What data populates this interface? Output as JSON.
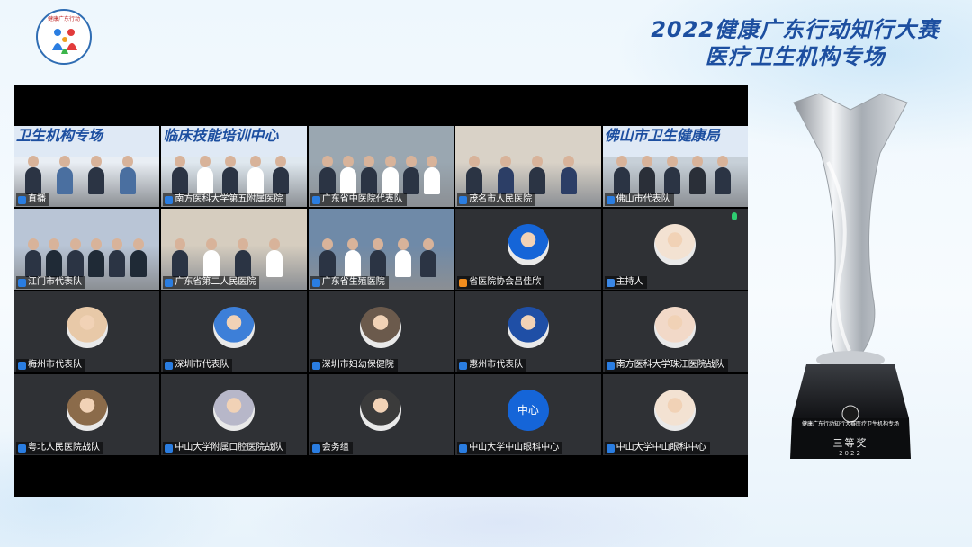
{
  "event": {
    "title_line1": "2022健康广东行动知行大赛",
    "title_line2": "医疗卫生机构专场",
    "logo_text": "健康广东行动"
  },
  "tiles": [
    {
      "name": "直播",
      "kind": "video",
      "icon": "screen-share-icon",
      "banner": "卫生机构专场"
    },
    {
      "name": "南方医科大学第五附属医院",
      "kind": "video",
      "icon": "video-participant-icon",
      "banner": "临床技能培训中心"
    },
    {
      "name": "广东省中医院代表队",
      "kind": "video",
      "icon": "video-participant-icon"
    },
    {
      "name": "茂名市人民医院",
      "kind": "video",
      "icon": "video-participant-icon"
    },
    {
      "name": "佛山市代表队",
      "kind": "video",
      "icon": "video-participant-icon",
      "banner": "佛山市卫生健康局"
    },
    {
      "name": "江门市代表队",
      "kind": "video",
      "icon": "video-participant-icon"
    },
    {
      "name": "广东省第二人民医院",
      "kind": "video",
      "icon": "video-participant-icon"
    },
    {
      "name": "广东省生殖医院",
      "kind": "video",
      "icon": "video-participant-icon"
    },
    {
      "name": "省医院协会吕佳欣",
      "kind": "avatar",
      "icon": "host-badge-icon",
      "icon_color": "#f08c1e"
    },
    {
      "name": "主持人",
      "kind": "avatar",
      "icon": "user-badge-icon",
      "icon_color": "#3a87e6",
      "mic": "microphone-on-icon"
    },
    {
      "name": "梅州市代表队",
      "kind": "avatar",
      "icon": "participant-icon"
    },
    {
      "name": "深圳市代表队",
      "kind": "avatar",
      "icon": "participant-icon"
    },
    {
      "name": "深圳市妇幼保健院",
      "kind": "avatar",
      "icon": "participant-icon"
    },
    {
      "name": "惠州市代表队",
      "kind": "avatar",
      "icon": "participant-icon"
    },
    {
      "name": "南方医科大学珠江医院战队",
      "kind": "avatar",
      "icon": "participant-icon"
    },
    {
      "name": "粤北人民医院战队",
      "kind": "avatar",
      "icon": "participant-icon"
    },
    {
      "name": "中山大学附属口腔医院战队",
      "kind": "avatar",
      "icon": "participant-icon"
    },
    {
      "name": "会务组",
      "kind": "avatar",
      "icon": "participant-icon"
    },
    {
      "name": "中山大学中山眼科中心",
      "kind": "text-avatar",
      "icon": "participant-icon",
      "avatar_text": "中心"
    },
    {
      "name": "中山大学中山眼科中心",
      "kind": "avatar",
      "icon": "participant-icon"
    }
  ],
  "award": {
    "plaque_text": "健康广东行动知行大赛医疗卫生机构专场",
    "rank": "三等奖",
    "year": "2022"
  },
  "colors": {
    "title_blue": "#1d4fa0",
    "meeting_bg": "#000000",
    "tile_bg": "#2f3135",
    "text_avatar_blue": "#1565d8"
  }
}
